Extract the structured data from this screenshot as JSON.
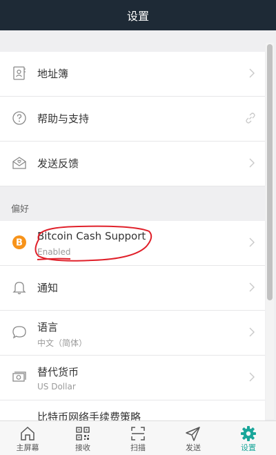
{
  "header": {
    "title": "设置"
  },
  "settings": {
    "items": [
      {
        "label": "地址簿"
      },
      {
        "label": "帮助与支持"
      },
      {
        "label": "发送反馈"
      }
    ],
    "preferences_header": "偏好",
    "preferences": [
      {
        "label": "Bitcoin Cash Support",
        "sublabel": "Enabled"
      },
      {
        "label": "通知"
      },
      {
        "label": "语言",
        "sublabel": "中文（简体）"
      },
      {
        "label": "替代货币",
        "sublabel": "US Dollar"
      },
      {
        "label": "比特币网络手续费策略"
      }
    ]
  },
  "tabs": [
    {
      "label": "主屏幕",
      "icon": "home-icon"
    },
    {
      "label": "接收",
      "icon": "qr-code-icon"
    },
    {
      "label": "扫描",
      "icon": "scan-icon"
    },
    {
      "label": "发送",
      "icon": "send-icon"
    },
    {
      "label": "设置",
      "icon": "gear-icon",
      "active": true
    }
  ],
  "colors": {
    "header_bg": "#1e2a36",
    "accent": "#1aa69a",
    "bitcoin_orange": "#f7931a",
    "annotation_red": "#e0202a"
  }
}
